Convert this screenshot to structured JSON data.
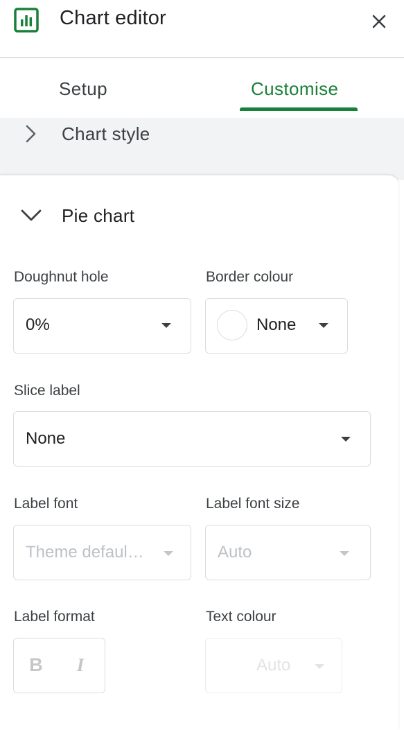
{
  "header": {
    "title": "Chart editor",
    "app_icon": "sheets-chart-icon",
    "close_icon": "close-icon",
    "accent_color": "#188038"
  },
  "tabs": [
    {
      "label": "Setup",
      "active": false
    },
    {
      "label": "Customise",
      "active": true
    }
  ],
  "sections": {
    "chart_style": {
      "label": "Chart style",
      "expanded": false
    },
    "pie_chart": {
      "label": "Pie chart",
      "expanded": true
    }
  },
  "pie_chart": {
    "doughnut_hole": {
      "label": "Doughnut hole",
      "value": "0%"
    },
    "border_colour": {
      "label": "Border colour",
      "value": "None"
    },
    "slice_label": {
      "label": "Slice label",
      "value": "None"
    },
    "label_font": {
      "label": "Label font",
      "value": "Theme defaul…",
      "disabled": true
    },
    "label_font_size": {
      "label": "Label font size",
      "value": "Auto",
      "disabled": true
    },
    "label_format": {
      "label": "Label format",
      "bold": "B",
      "italic": "I",
      "disabled": true
    },
    "text_colour": {
      "label": "Text colour",
      "value": "Auto",
      "disabled": true
    }
  }
}
